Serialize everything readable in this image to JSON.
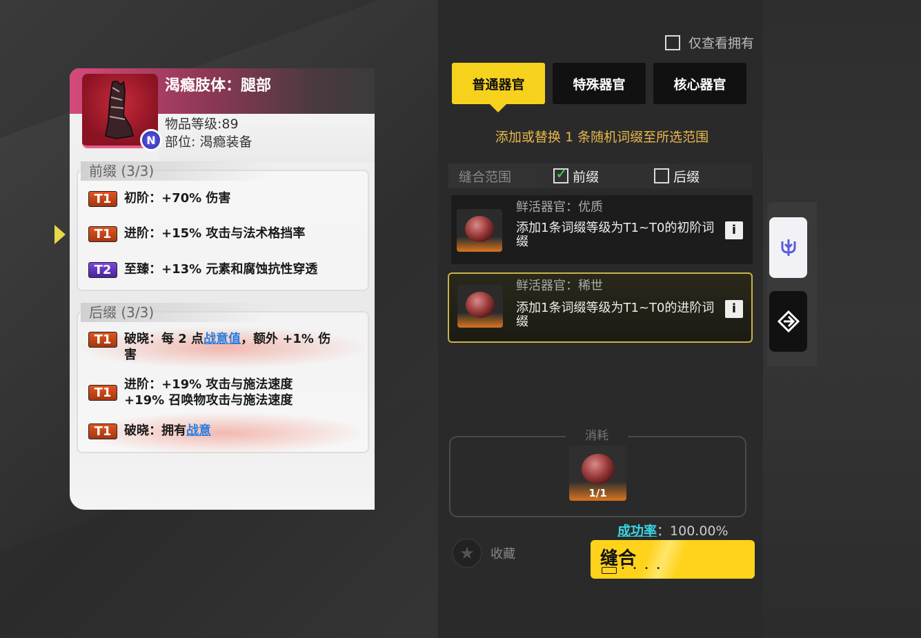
{
  "item": {
    "name": "渴瘾肢体：腿部",
    "level": "物品等级:89",
    "slot": "部位: 渴瘾装备"
  },
  "prefix": {
    "title": "前缀 (3/3)",
    "affixes": [
      {
        "tier": "T1",
        "text": "初阶：+70% 伤害"
      },
      {
        "tier": "T1",
        "text": "进阶：+15% 攻击与法术格挡率"
      },
      {
        "tier": "T2",
        "text": "至臻：+13% 元素和腐蚀抗性穿透"
      }
    ]
  },
  "suffix": {
    "title": "后缀 (3/3)",
    "affixes": [
      {
        "tier": "T1",
        "text_a": "破晓：每 2 点",
        "link": "战意值",
        "text_b": "，额外 +1% 伤害"
      },
      {
        "tier": "T1",
        "line1": "进阶：+19% 攻击与施法速度",
        "line2": "+19% 召唤物攻击与施法速度"
      },
      {
        "tier": "T1",
        "text_a": "破晓：拥有",
        "link": "战意"
      }
    ]
  },
  "filter": {
    "owned_only_label": "仅查看拥有",
    "owned_only_checked": false
  },
  "tabs": [
    {
      "label": "普通器官",
      "active": true
    },
    {
      "label": "特殊器官",
      "active": false
    },
    {
      "label": "核心器官",
      "active": false
    }
  ],
  "hint": "添加或替换 1 条随机词缀至所选范围",
  "range": {
    "label": "缝合范围",
    "options": [
      {
        "label": "前缀",
        "checked": true
      },
      {
        "label": "后缀",
        "checked": false
      }
    ]
  },
  "materials": [
    {
      "title": "鲜活器官：优质",
      "desc": "添加1条词缀等级为T1~T0的初阶词缀",
      "selected": false
    },
    {
      "title": "鲜活器官：稀世",
      "desc": "添加1条词缀等级为T1~T0的进阶词缀",
      "selected": true
    }
  ],
  "consume": {
    "label": "消耗",
    "count": "1/1"
  },
  "success": {
    "label": "成功率",
    "value": "：100.00%"
  },
  "favorite_label": "收藏",
  "sew_button": "缝合",
  "colors": {
    "accent": "#f7d21c",
    "t1": "#c8461a",
    "t2": "#5e35b8",
    "link": "#2a7de0"
  }
}
